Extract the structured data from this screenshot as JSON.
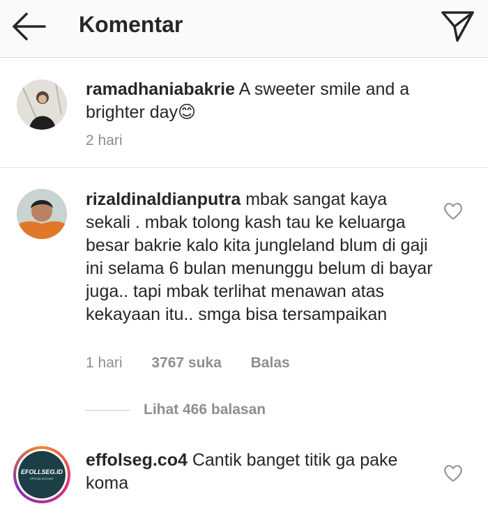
{
  "header": {
    "back_icon": "arrow-left-icon",
    "title": "Komentar",
    "send_icon": "paper-plane-icon"
  },
  "caption": {
    "username": "ramadhaniabakrie",
    "text": "A sweeter smile and a brighter day",
    "emoji": "😊",
    "time": "2 hari"
  },
  "comments": [
    {
      "username": "rizaldinaldianputra",
      "text": "mbak sangat kaya sekali . mbak tolong kash tau ke keluarga besar bakrie kalo kita jungleland blum di gaji ini selama 6 bulan menunggu belum di bayar juga.. tapi mbak terlihat menawan atas kekayaan itu.. smga bisa tersampaikan",
      "time": "1 hari",
      "likes": "3767 suka",
      "reply_label": "Balas",
      "view_replies": "Lihat 466 balasan"
    },
    {
      "username": "effolseg.co4",
      "text": "Cantik banget titik ga pake koma",
      "avatar_text": "EFOLLSEG.ID",
      "avatar_subtext": "OFFICIAL ACCOUNT"
    }
  ],
  "colors": {
    "text": "#262626",
    "muted": "#8e8e8e",
    "story_ring_start": "#f58529",
    "story_ring_end": "#dd2a7b"
  }
}
